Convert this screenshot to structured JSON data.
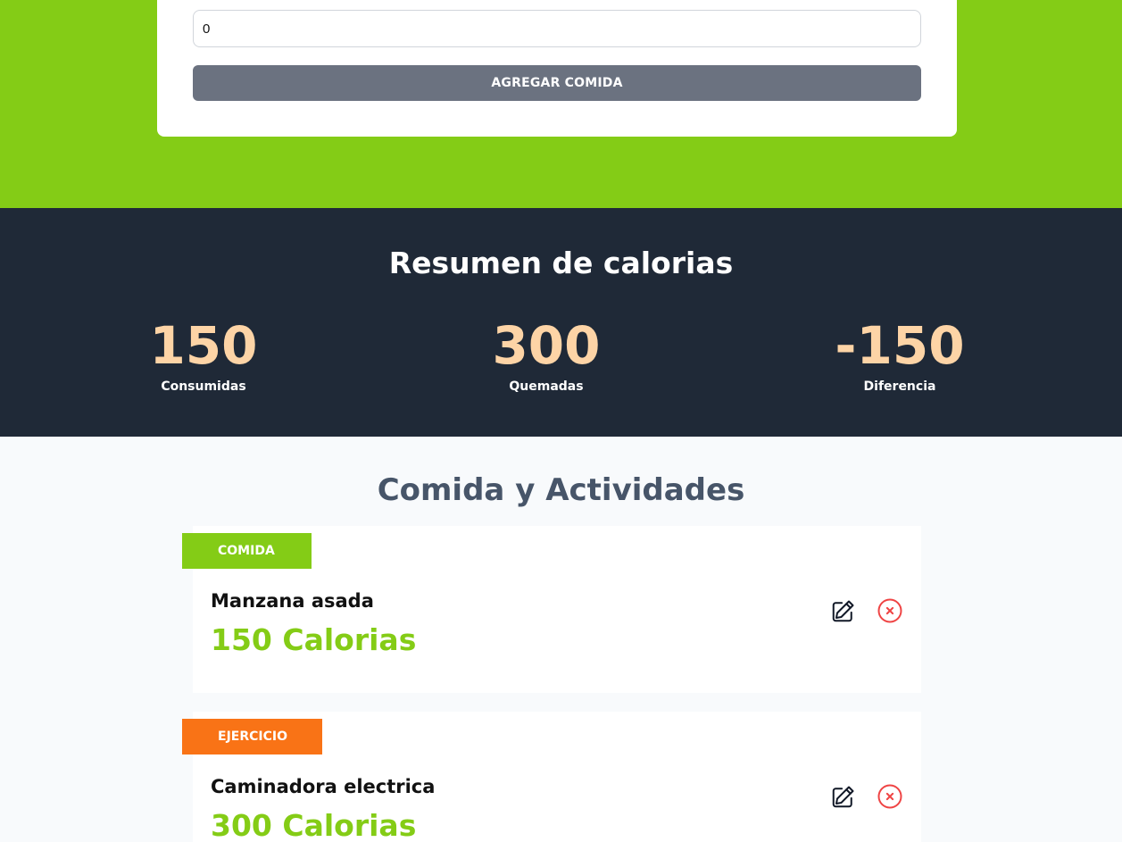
{
  "form": {
    "calories_value": "0",
    "submit_label": "AGREGAR COMIDA"
  },
  "summary": {
    "title": "Resumen de calorias",
    "stats": [
      {
        "value": "150",
        "label": "Consumidas"
      },
      {
        "value": "300",
        "label": "Quemadas"
      },
      {
        "value": "-150",
        "label": "Diferencia"
      }
    ]
  },
  "activities": {
    "title": "Comida y Actividades",
    "items": [
      {
        "category": "COMIDA",
        "name": "Manzana asada",
        "calories": "150 Calorias",
        "icons": [
          "edit-icon",
          "delete-circle-x-icon"
        ]
      },
      {
        "category": "EJERCICIO",
        "name": "Caminadora electrica",
        "calories": "300 Calorias",
        "icons": [
          "edit-icon",
          "delete-circle-x-icon"
        ]
      }
    ]
  },
  "colors": {
    "brand_green": "#84cc16",
    "dark_bg": "#1f2937",
    "stat_number": "#fdd4a6",
    "exercise_orange": "#f97316",
    "button_gray": "#6b7280",
    "delete_red": "#ef4444"
  }
}
